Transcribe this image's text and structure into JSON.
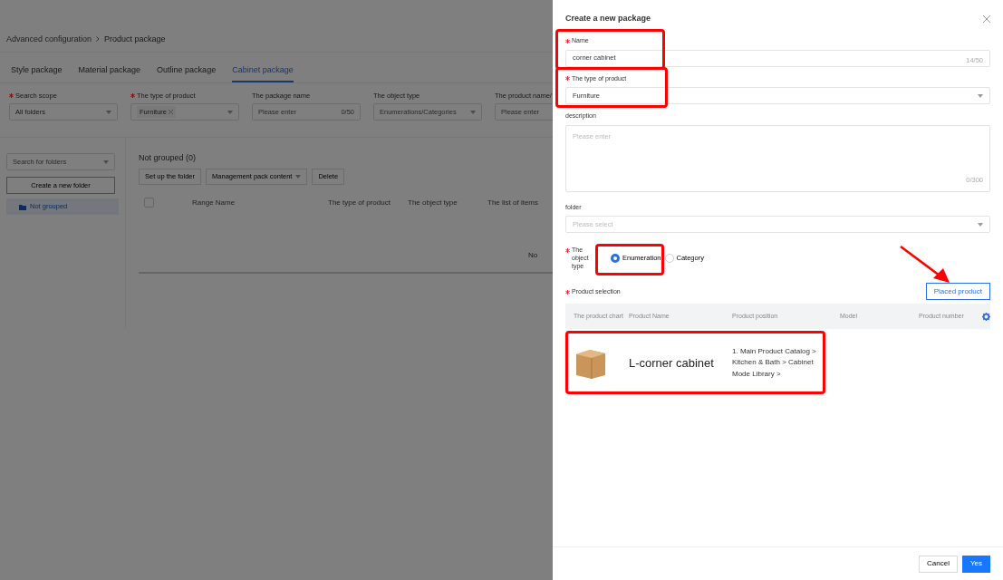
{
  "breadcrumb": [
    "Advanced configuration",
    "Product package"
  ],
  "tabs": [
    {
      "label": "Style package",
      "selected": false
    },
    {
      "label": "Material package",
      "selected": false
    },
    {
      "label": "Outline package",
      "selected": false
    },
    {
      "label": "Cabinet package",
      "selected": true
    }
  ],
  "filters": [
    {
      "label": "Search scope",
      "required": true,
      "kind": "select",
      "value": "All folders"
    },
    {
      "label": "The type of product",
      "required": true,
      "kind": "tag-select",
      "value": "Furniture"
    },
    {
      "label": "The package name",
      "required": false,
      "kind": "input",
      "placeholder": "Please enter",
      "counter": "0/50"
    },
    {
      "label": "The object type",
      "required": false,
      "kind": "select",
      "placeholder": "Enumerations/Categories"
    },
    {
      "label": "The product name/",
      "required": false,
      "kind": "input",
      "placeholder": "Please enter"
    }
  ],
  "sidebar": {
    "search_placeholder": "Search for folders",
    "create_button": "Create a new folder",
    "items": [
      {
        "label": "Not grouped",
        "selected": true
      }
    ]
  },
  "content": {
    "title": "Not grouped",
    "count": "(0)",
    "buttons": [
      {
        "label": "Set up the folder",
        "kind": "plain"
      },
      {
        "label": "Management pack content",
        "kind": "dropdown"
      },
      {
        "label": "Delete",
        "kind": "plain"
      }
    ],
    "table": {
      "select_all_checked": false,
      "columns": [
        "Range Name",
        "The type of product",
        "The object type",
        "The list of items"
      ],
      "empty_text": "No"
    }
  },
  "drawer": {
    "title": "Create a new package",
    "fields": [
      {
        "kind": "text",
        "label": "Name",
        "required": true,
        "value": "corner cabinet",
        "counter": "14/50",
        "highlighted": true
      },
      {
        "kind": "select",
        "label": "The type of product",
        "required": true,
        "value": "Furniture",
        "highlighted": true
      },
      {
        "kind": "textarea",
        "label": "description",
        "required": false,
        "placeholder": "Please enter",
        "counter": "0/300",
        "highlighted": false
      },
      {
        "kind": "select",
        "label": "folder",
        "required": false,
        "placeholder": "Please select",
        "highlighted": false
      },
      {
        "kind": "radio",
        "label": "The object type",
        "required": true,
        "highlighted": true,
        "options": [
          {
            "label": "Enumeration",
            "selected": true
          },
          {
            "label": "Category",
            "selected": false
          }
        ]
      }
    ],
    "product_selection": {
      "label": "Product selection",
      "required": true,
      "button": {
        "label": "Placed product",
        "pointed": true
      },
      "columns": [
        "The product chart",
        "Product Name",
        "Product position",
        "Model",
        "Product number"
      ],
      "rows": [
        {
          "name": "L-corner cabinet",
          "position": "1. Main Product Catalog > Kitchen & Bath > Cabinet Mode Library >",
          "highlighted": true
        }
      ]
    },
    "footer_buttons": [
      {
        "label": "Cancel",
        "primary": false
      },
      {
        "label": "Yes",
        "primary": true
      }
    ]
  }
}
